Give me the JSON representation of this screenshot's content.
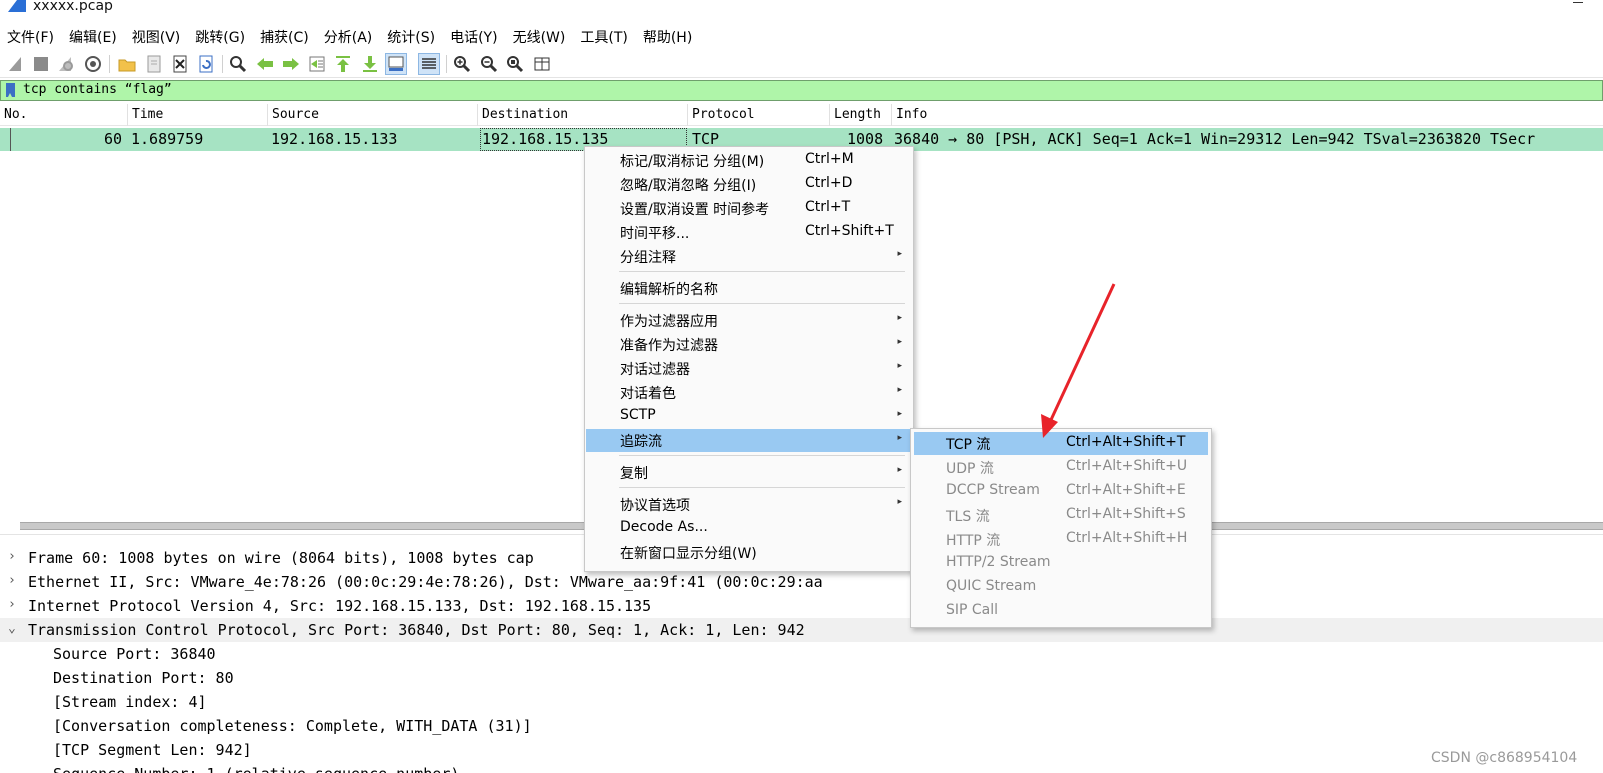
{
  "window": {
    "title": "xxxxx.pcap"
  },
  "menubar": [
    "文件(F)",
    "编辑(E)",
    "视图(V)",
    "跳转(G)",
    "捕获(C)",
    "分析(A)",
    "统计(S)",
    "电话(Y)",
    "无线(W)",
    "工具(T)",
    "帮助(H)"
  ],
  "toolbar": {
    "icons": [
      "shark-fin-start-icon",
      "stop-icon",
      "restart-icon",
      "capture-options-icon",
      "open-file-icon",
      "save-file-icon",
      "close-file-icon",
      "reload-icon",
      "find-icon",
      "go-back-icon",
      "go-forward-icon",
      "go-to-packet-icon",
      "go-first-icon",
      "go-last-icon",
      "auto-scroll-icon",
      "colorize-icon",
      "zoom-in-icon",
      "zoom-out-icon",
      "zoom-normal-icon",
      "resize-columns-icon"
    ]
  },
  "filter": {
    "value": "tcp contains “flag”"
  },
  "packet_list": {
    "columns": [
      "No.",
      "Time",
      "Source",
      "Destination",
      "Protocol",
      "Length",
      "Info"
    ],
    "rows": [
      {
        "no": "60",
        "time": "1.689759",
        "source": "192.168.15.133",
        "destination": "192.168.15.135",
        "protocol": "TCP",
        "length": "1008",
        "info": "36840 → 80 [PSH, ACK] Seq=1 Ack=1 Win=29312 Len=942 TSval=2363820 TSecr"
      }
    ]
  },
  "details": {
    "rows": [
      {
        "arrow": "›",
        "text": "Frame 60: 1008 bytes on wire (8064 bits), 1008 bytes cap"
      },
      {
        "arrow": "›",
        "text": "Ethernet II, Src: VMware_4e:78:26 (00:0c:29:4e:78:26), Dst: VMware_aa:9f:41 (00:0c:29:aa"
      },
      {
        "arrow": "›",
        "text": "Internet Protocol Version 4, Src: 192.168.15.133, Dst: 192.168.15.135"
      },
      {
        "arrow": "⌄",
        "text": "Transmission Control Protocol, Src Port: 36840, Dst Port: 80, Seq: 1, Ack: 1, Len: 942"
      },
      {
        "arrow": "",
        "text": "Source Port: 36840"
      },
      {
        "arrow": "",
        "text": "Destination Port: 80"
      },
      {
        "arrow": "",
        "text": "[Stream index: 4]"
      },
      {
        "arrow": "",
        "text": "[Conversation completeness: Complete, WITH_DATA (31)]"
      },
      {
        "arrow": "",
        "text": "[TCP Segment Len: 942]"
      },
      {
        "arrow": "",
        "text": "Sequence Number: 1    (relative sequence number)"
      }
    ]
  },
  "context_menu": {
    "items": [
      {
        "label": "标记/取消标记 分组(M)",
        "shortcut": "Ctrl+M"
      },
      {
        "label": "忽略/取消忽略 分组(I)",
        "shortcut": "Ctrl+D"
      },
      {
        "label": "设置/取消设置 时间参考",
        "shortcut": "Ctrl+T"
      },
      {
        "label": "时间平移...",
        "shortcut": "Ctrl+Shift+T"
      },
      {
        "label": "分组注释",
        "shortcut": "",
        "submenu": "▸"
      },
      {
        "label": "编辑解析的名称",
        "shortcut": ""
      },
      {
        "label": "作为过滤器应用",
        "shortcut": "",
        "submenu": "▸"
      },
      {
        "label": "准备作为过滤器",
        "shortcut": "",
        "submenu": "▸"
      },
      {
        "label": "对话过滤器",
        "shortcut": "",
        "submenu": "▸"
      },
      {
        "label": "对话着色",
        "shortcut": "",
        "submenu": "▸"
      },
      {
        "label": "SCTP",
        "shortcut": "",
        "submenu": "▸"
      },
      {
        "label": "追踪流",
        "shortcut": "",
        "submenu": "▸",
        "highlighted": true
      },
      {
        "label": "复制",
        "shortcut": "",
        "submenu": "▸"
      },
      {
        "label": "协议首选项",
        "shortcut": "",
        "submenu": "▸"
      },
      {
        "label": "Decode As...",
        "shortcut": ""
      },
      {
        "label": "在新窗口显示分组(W)",
        "shortcut": ""
      }
    ]
  },
  "follow_submenu": {
    "items": [
      {
        "label": "TCP 流",
        "shortcut": "Ctrl+Alt+Shift+T",
        "highlighted": true
      },
      {
        "label": "UDP 流",
        "shortcut": "Ctrl+Alt+Shift+U"
      },
      {
        "label": "DCCP Stream",
        "shortcut": "Ctrl+Alt+Shift+E"
      },
      {
        "label": "TLS 流",
        "shortcut": "Ctrl+Alt+Shift+S"
      },
      {
        "label": "HTTP 流",
        "shortcut": "Ctrl+Alt+Shift+H"
      },
      {
        "label": "HTTP/2 Stream",
        "shortcut": ""
      },
      {
        "label": "QUIC Stream",
        "shortcut": ""
      },
      {
        "label": "SIP Call",
        "shortcut": ""
      }
    ]
  },
  "annotation": {
    "arrow_color": "#e8232a"
  },
  "watermark": "CSDN @c868954104"
}
